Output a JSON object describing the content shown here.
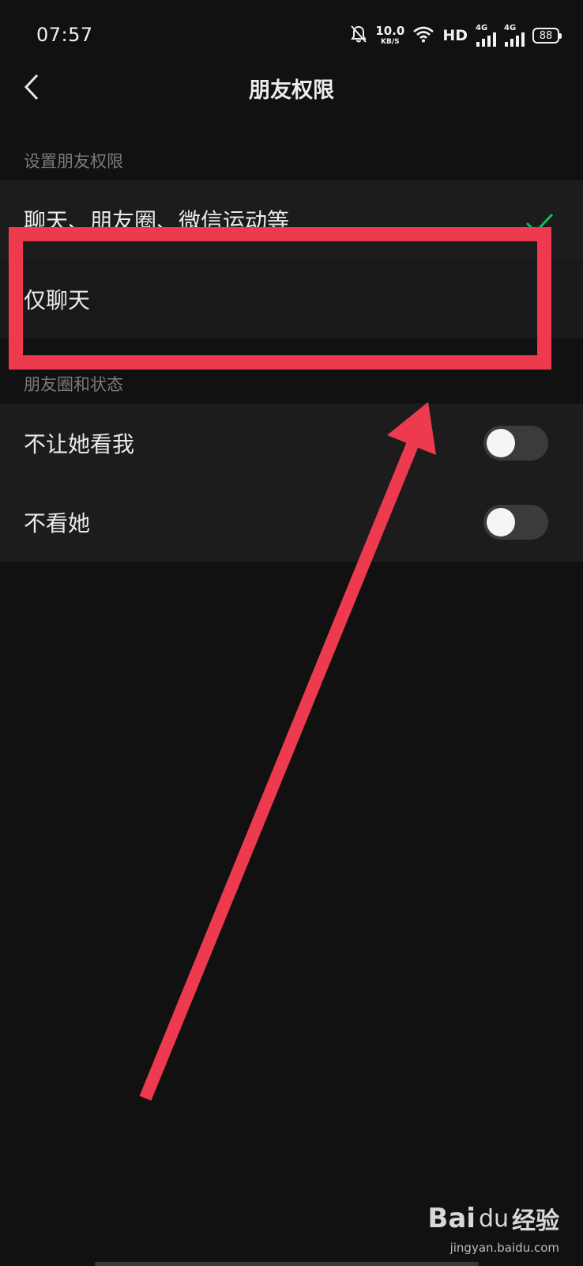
{
  "status_bar": {
    "time": "07:57",
    "net_speed_value": "10.0",
    "net_speed_unit": "KB/S",
    "hd_label": "HD",
    "signal1_label": "4G",
    "signal2_label": "4G",
    "battery_level": "88",
    "icons": [
      "mute-bell-icon",
      "wifi-icon",
      "signal-icon",
      "battery-icon"
    ]
  },
  "nav": {
    "title": "朋友权限",
    "back_icon": "chevron-left-icon"
  },
  "permission_section": {
    "header": "设置朋友权限",
    "options": [
      {
        "label": "聊天、朋友圈、微信运动等",
        "selected": true
      },
      {
        "label": "仅聊天",
        "selected": false
      }
    ]
  },
  "moments_section": {
    "header": "朋友圈和状态",
    "toggles": [
      {
        "label": "不让她看我",
        "on": false
      },
      {
        "label": "不看她",
        "on": false
      }
    ]
  },
  "watermark": {
    "logo": "Bai",
    "logo_paw": "du",
    "jingyan": "经验",
    "url": "jingyan.baidu.com"
  },
  "colors": {
    "background": "#111111",
    "card": "#1c1c1c",
    "accent_check": "#07c160",
    "annotation": "#ee3a4e"
  }
}
